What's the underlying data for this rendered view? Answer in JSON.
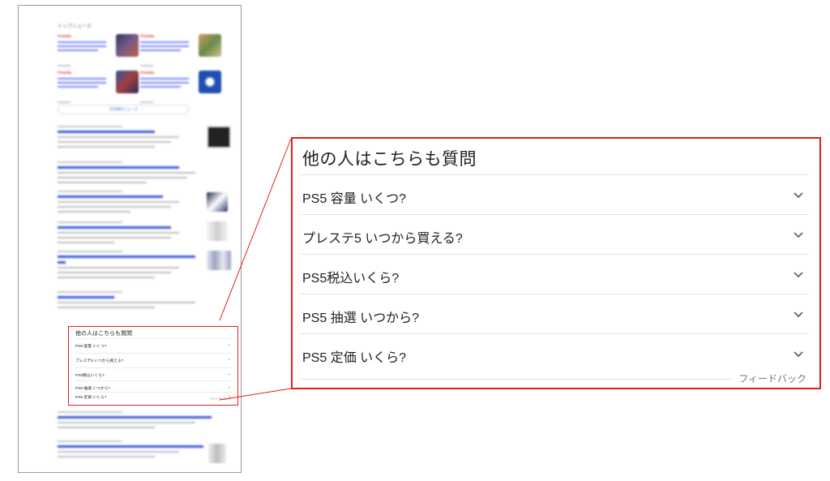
{
  "mini_page": {
    "top_news_label": "トップニュース",
    "news_source": "ITmedia",
    "more_news_label": "その他のニュース",
    "paa_title": "他の人はこちらも質問",
    "paa_questions": [
      "PS5 容量 いくつ?",
      "プレステ5 いつから買える?",
      "PS5税込いくら?",
      "PS5 抽選 いつから?",
      "PS5 定価 いくら?"
    ],
    "feedback_label": "フィードバック"
  },
  "paa": {
    "title": "他の人はこちらも質問",
    "questions": [
      {
        "label": "PS5 容量 いくつ?"
      },
      {
        "label": "プレステ5 いつから買える?"
      },
      {
        "label": "PS5税込いくら?"
      },
      {
        "label": "PS5 抽選 いつから?"
      },
      {
        "label": "PS5 定価 いくら?"
      }
    ],
    "feedback_label": "フィードバック"
  },
  "colors": {
    "highlight_border": "#e02020",
    "link_blue": "#3b5bdb",
    "divider": "#e0e0e0"
  }
}
